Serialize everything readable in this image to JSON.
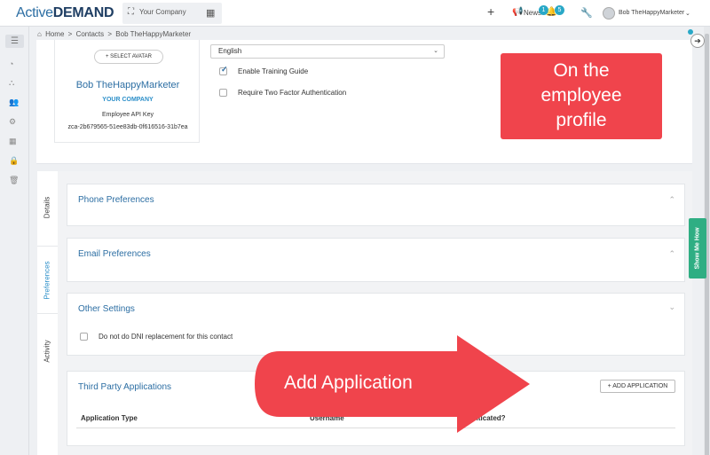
{
  "topbar": {
    "logo_part1": "Active",
    "logo_part2": "DEMAND",
    "company": "Your Company",
    "news_label": "News",
    "news_badge": "1",
    "notif_badge": "5",
    "user_name": "Bob TheHappyMarketer"
  },
  "breadcrumb": {
    "home": "Home",
    "sep1": ">",
    "contacts": "Contacts",
    "sep2": ">",
    "current": "Bob TheHappyMarketer"
  },
  "profile": {
    "select_avatar": "+ SELECT AVATAR",
    "name": "Bob TheHappyMarketer",
    "company": "YOUR COMPANY",
    "api_key_label": "Employee API Key",
    "api_key": "zca-2b679565-51ee83db-0f616516-31b7ea"
  },
  "settings": {
    "language": "English",
    "enable_training_guide": "Enable Training Guide",
    "require_2fa": "Require Two Factor Authentication"
  },
  "callouts": {
    "employee_profile_line1": "On the",
    "employee_profile_line2": "employee",
    "employee_profile_line3": "profile",
    "add_application": "Add Application"
  },
  "tabs": [
    {
      "label": "Details"
    },
    {
      "label": "Preferences"
    },
    {
      "label": "Activity"
    }
  ],
  "panels": {
    "phone": "Phone Preferences",
    "email": "Email Preferences",
    "other": "Other Settings",
    "dni": "Do not do DNI replacement for this contact",
    "third_party": "Third Party Applications",
    "add_app_button": "+ ADD APPLICATION",
    "col_app_type": "Application Type",
    "col_username": "Username",
    "col_authenticated": "nticated?"
  },
  "show_me_how": "Show Me How",
  "colors": {
    "brand_blue": "#2c6ea3",
    "callout_red": "#f0444c",
    "show_me_green": "#2fae83",
    "badge_teal": "#29a8c7"
  }
}
